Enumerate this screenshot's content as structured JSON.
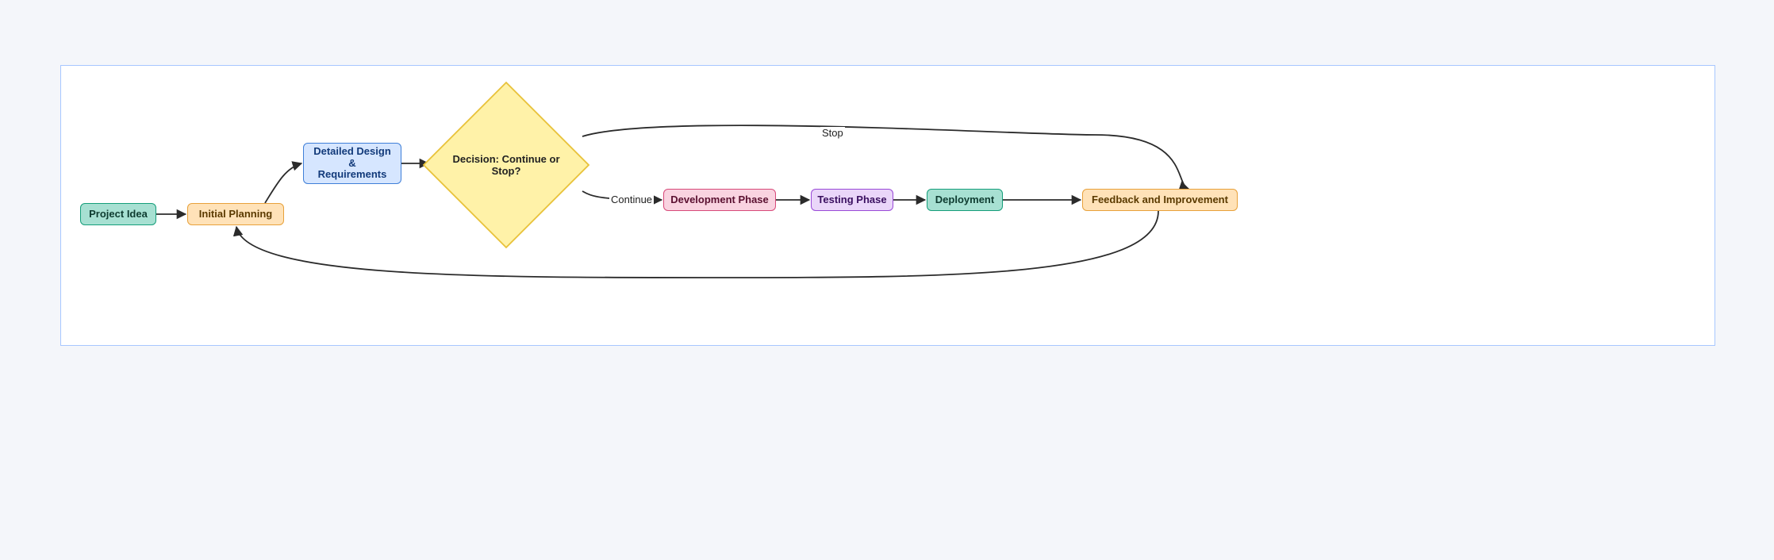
{
  "diagram_type": "flowchart",
  "nodes": {
    "idea": {
      "label": "Project Idea",
      "style": "teal"
    },
    "planning": {
      "label": "Initial Planning",
      "style": "orange"
    },
    "design": {
      "label": "Detailed Design\n&\nRequirements",
      "style": "blue"
    },
    "decision": {
      "label": "Decision: Continue or Stop?",
      "style": "diamond"
    },
    "development": {
      "label": "Development Phase",
      "style": "pink"
    },
    "testing": {
      "label": "Testing Phase",
      "style": "purple"
    },
    "deploy": {
      "label": "Deployment",
      "style": "teal"
    },
    "feedback": {
      "label": "Feedback and Improvement",
      "style": "orange"
    }
  },
  "edges": [
    {
      "from": "idea",
      "to": "planning"
    },
    {
      "from": "planning",
      "to": "design"
    },
    {
      "from": "design",
      "to": "decision"
    },
    {
      "from": "decision",
      "to": "development",
      "label": "Continue"
    },
    {
      "from": "decision",
      "to": "feedback",
      "label": "Stop"
    },
    {
      "from": "development",
      "to": "testing"
    },
    {
      "from": "testing",
      "to": "deploy"
    },
    {
      "from": "deploy",
      "to": "feedback"
    },
    {
      "from": "feedback",
      "to": "planning"
    }
  ],
  "edge_labels": {
    "continue": "Continue",
    "stop": "Stop"
  },
  "colors": {
    "teal_fill": "#a7e0d2",
    "teal_stroke": "#159e7a",
    "orange_fill": "#ffe2b8",
    "orange_stroke": "#e8a13a",
    "blue_fill": "#d6e6ff",
    "blue_stroke": "#3f7fd8",
    "pink_fill": "#f9d3e0",
    "pink_stroke": "#d84a7a",
    "purple_fill": "#ead6f9",
    "purple_stroke": "#9a4ad8",
    "diamond_fill": "#fff2a8",
    "diamond_stroke": "#e8c23a",
    "edge": "#2b2b2b",
    "frame_border": "#a8c7ff",
    "page_bg": "#f4f6fa"
  }
}
